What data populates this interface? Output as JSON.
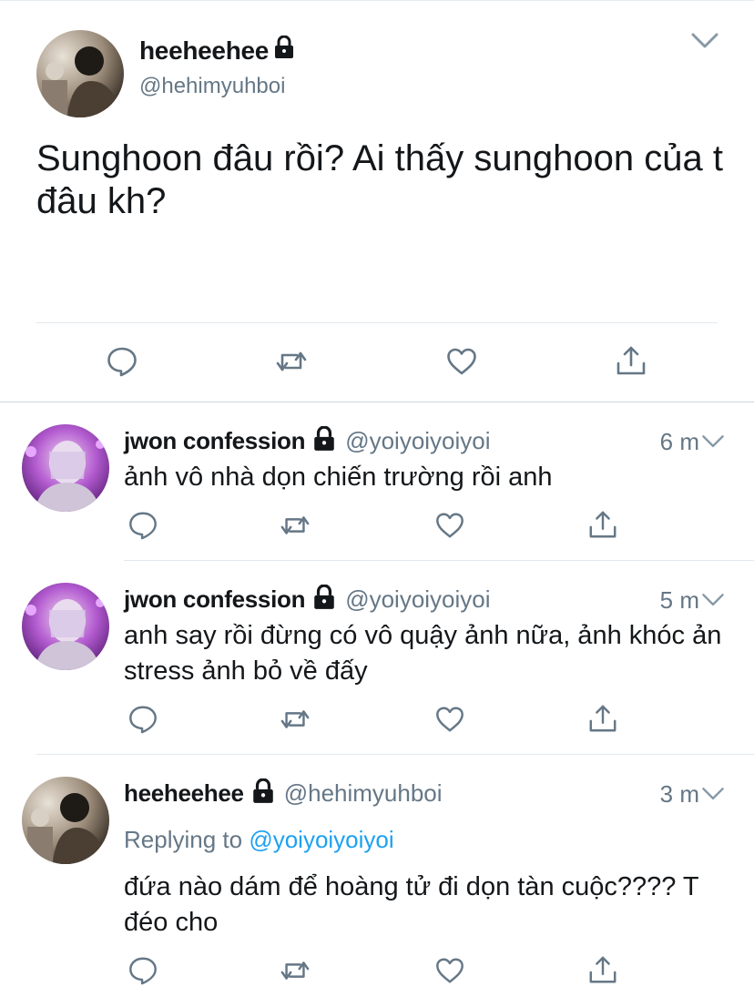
{
  "main_tweet": {
    "display_name": "heeheehee",
    "handle": "@hehimyuhboi",
    "text": "Sunghoon đâu rồi? Ai thấy sunghoon của t đâu kh?",
    "avatar_icon": "user-photo-avatar",
    "locked_icon": "lock-icon"
  },
  "replies": [
    {
      "display_name": "jwon confession",
      "handle": "@yoiyoiyoiyoi",
      "time": "6 m",
      "text": "ảnh vô nhà dọn chiến trường rồi anh"
    },
    {
      "display_name": "jwon confession",
      "handle": "@yoiyoiyoiyoi",
      "time": "5 m",
      "text": "anh say rồi đừng có vô quậy ảnh nữa, ảnh khóc ản stress ảnh bỏ về đấy"
    },
    {
      "display_name": "heeheehee",
      "handle": "@hehimyuhboi",
      "time": "3 m",
      "replying_prefix": "Replying to",
      "replying_mention": "@yoiyoiyoiyoi",
      "text": "đứa nào dám để hoàng tử đi dọn tàn cuộc???? T đéo cho"
    }
  ],
  "colors": {
    "text": "#14171a",
    "secondary": "#657786",
    "link": "#1da1f2",
    "divider": "#e1e8ed"
  }
}
